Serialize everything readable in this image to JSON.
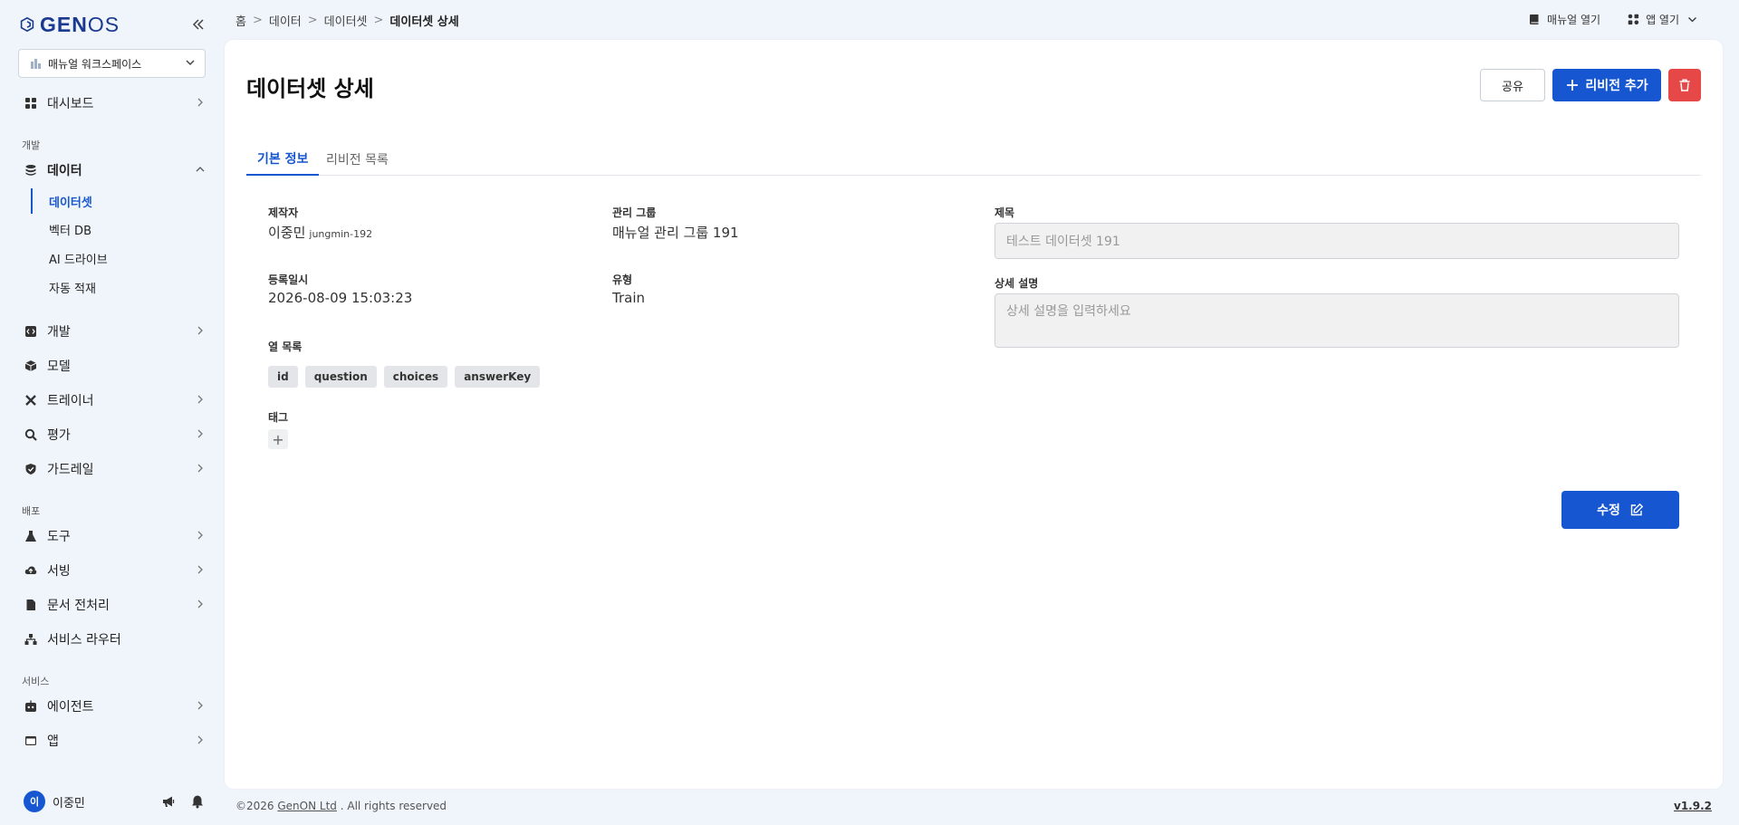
{
  "app": {
    "logo_left": "GEN",
    "logo_right": "OS"
  },
  "workspace": {
    "selected": "매뉴얼 워크스페이스"
  },
  "sidebar": {
    "dashboard": "대시보드",
    "section_dev": "개발",
    "data": "데이터",
    "data_sub": [
      "데이터셋",
      "벡터 DB",
      "AI 드라이브",
      "자동 적재"
    ],
    "dev": "개발",
    "model": "모델",
    "trainer": "트레이너",
    "eval": "평가",
    "guardrail": "가드레일",
    "section_deploy": "배포",
    "tools": "도구",
    "serving": "서빙",
    "doc_preprocess": "문서 전처리",
    "service_router": "서비스 라우터",
    "section_service": "서비스",
    "agent": "에이전트",
    "app": "앱"
  },
  "user": {
    "initial": "이",
    "name": "이중민"
  },
  "breadcrumb": [
    "홈",
    "데이터",
    "데이터셋",
    "데이터셋 상세"
  ],
  "top_actions": {
    "manual": "매뉴얼 열기",
    "app_open": "앱 열기"
  },
  "page": {
    "title": "데이터셋 상세",
    "share": "공유",
    "add_revision": "리비전 추가",
    "tabs": [
      "기본 정보",
      "리비전 목록"
    ],
    "creator_label": "제작자",
    "creator_name": "이중민",
    "creator_id": "jungmin-192",
    "group_label": "관리 그룹",
    "group_value": "매뉴얼 관리 그룹 191",
    "registered_label": "등록일시",
    "registered_value": "2026-08-09 15:03:23",
    "type_label": "유형",
    "type_value": "Train",
    "columns_label": "열 목록",
    "columns": [
      "id",
      "question",
      "choices",
      "answerKey"
    ],
    "tags_label": "태그",
    "tag_add": "+",
    "title_label": "제목",
    "title_placeholder": "테스트 데이터셋 191",
    "desc_label": "상세 설명",
    "desc_placeholder": "상세 설명을 입력하세요",
    "edit": "수정"
  },
  "footer": {
    "copyright": "©2026",
    "company": "GenON Ltd",
    "rights": ". All rights reserved",
    "version": "v1.9.2"
  },
  "colors": {
    "primary": "#1657d1",
    "danger": "#e64848",
    "background": "#f0f5fb"
  }
}
